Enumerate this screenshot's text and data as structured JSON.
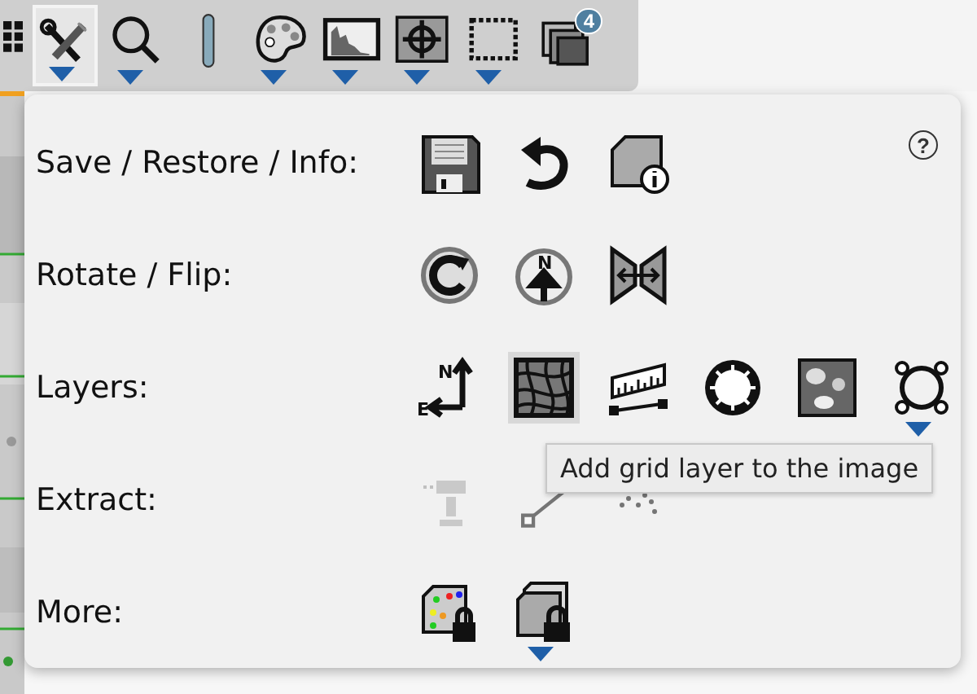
{
  "toolbar": [
    {
      "selected": false,
      "menu": false
    },
    {
      "selected": true,
      "menu": true
    },
    {
      "selected": false,
      "menu": true
    },
    {
      "selected": false,
      "menu": false
    },
    {
      "selected": false,
      "menu": true
    },
    {
      "selected": false,
      "menu": true
    },
    {
      "selected": false,
      "menu": true
    },
    {
      "selected": false,
      "menu": true
    },
    {
      "selected": false,
      "menu": false,
      "badge": "4"
    }
  ],
  "panel": {
    "help": "?",
    "rows": [
      {
        "label": "Save / Restore / Info:",
        "tools": [
          {
            "selected": false,
            "disabled": false,
            "menu": false
          },
          {
            "selected": false,
            "disabled": false,
            "menu": false
          },
          {
            "selected": false,
            "disabled": false,
            "menu": false
          }
        ]
      },
      {
        "label": "Rotate / Flip:",
        "tools": [
          {
            "selected": false,
            "disabled": false,
            "menu": false
          },
          {
            "selected": false,
            "disabled": false,
            "menu": false,
            "letters": [
              "N"
            ]
          },
          {
            "selected": false,
            "disabled": false,
            "menu": false
          }
        ]
      },
      {
        "label": "Layers:",
        "tools": [
          {
            "selected": false,
            "disabled": false,
            "menu": false,
            "letters": [
              "N",
              "E"
            ]
          },
          {
            "selected": true,
            "disabled": false,
            "menu": false
          },
          {
            "selected": false,
            "disabled": false,
            "menu": false
          },
          {
            "selected": false,
            "disabled": false,
            "menu": false
          },
          {
            "selected": false,
            "disabled": false,
            "menu": false
          },
          {
            "selected": false,
            "disabled": false,
            "menu": true
          }
        ]
      },
      {
        "label": "Extract:",
        "tools": [
          {
            "selected": false,
            "disabled": true,
            "menu": false
          },
          {
            "selected": false,
            "disabled": true,
            "menu": false
          },
          {
            "selected": false,
            "disabled": true,
            "menu": false
          }
        ]
      },
      {
        "label": "More:",
        "tools": [
          {
            "selected": false,
            "disabled": false,
            "menu": false
          },
          {
            "selected": false,
            "disabled": false,
            "menu": true
          }
        ]
      }
    ]
  },
  "tooltip": "Add grid layer to the image"
}
